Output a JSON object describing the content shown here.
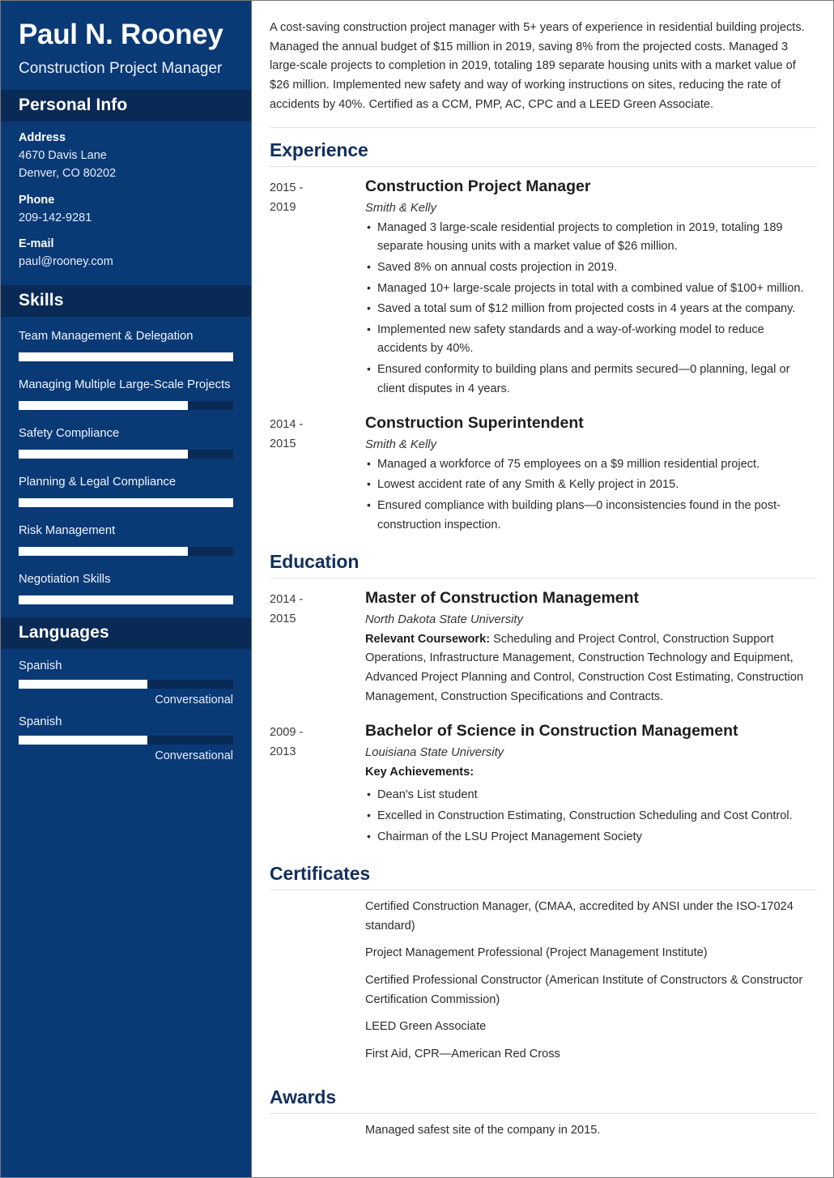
{
  "sidebar": {
    "name": "Paul N. Rooney",
    "job_title": "Construction Project Manager",
    "personal_info": {
      "heading": "Personal Info",
      "address_label": "Address",
      "address_line1": "4670 Davis Lane",
      "address_line2": "Denver, CO 80202",
      "phone_label": "Phone",
      "phone_value": "209-142-9281",
      "email_label": "E-mail",
      "email_value": "paul@rooney.com"
    },
    "skills": {
      "heading": "Skills",
      "items": [
        {
          "label": "Team Management & Delegation",
          "level": 100
        },
        {
          "label": "Managing Multiple Large-Scale Projects",
          "level": 79
        },
        {
          "label": "Safety Compliance",
          "level": 79
        },
        {
          "label": "Planning & Legal Compliance",
          "level": 100
        },
        {
          "label": "Risk Management",
          "level": 79
        },
        {
          "label": "Negotiation Skills",
          "level": 100
        }
      ]
    },
    "languages": {
      "heading": "Languages",
      "items": [
        {
          "label": "Spanish",
          "level": 60,
          "proficiency": "Conversational"
        },
        {
          "label": "Spanish",
          "level": 60,
          "proficiency": "Conversational"
        }
      ]
    }
  },
  "main": {
    "summary": "A cost-saving construction project manager with 5+ years of experience in residential building projects. Managed the annual budget of $15 million in 2019, saving 8% from the projected costs. Managed 3 large-scale projects to completion in 2019, totaling 189 separate housing units with a market value of $26 million. Implemented new safety and way of working instructions on sites, reducing the rate of accidents by 40%. Certified as a CCM, PMP, AC, CPC and a LEED Green Associate.",
    "experience": {
      "heading": "Experience",
      "entries": [
        {
          "dates": "2015 - 2019",
          "title": "Construction Project Manager",
          "company": "Smith & Kelly",
          "bullets": [
            "Managed 3 large-scale residential projects to completion in 2019, totaling 189 separate housing units with a market value of $26 million.",
            "Saved 8% on annual costs projection in 2019.",
            "Managed 10+ large-scale projects in total with a combined value of $100+ million.",
            "Saved a total sum of $12 million from projected costs in 4 years at the company.",
            "Implemented new safety standards and a way-of-working model to reduce accidents by 40%.",
            "Ensured conformity to building plans and permits secured—0 planning, legal or client disputes in 4 years."
          ]
        },
        {
          "dates": "2014 - 2015",
          "title": "Construction Superintendent",
          "company": "Smith & Kelly",
          "bullets": [
            "Managed a workforce of 75 employees on a $9 million residential project.",
            "Lowest accident rate of any Smith & Kelly project in 2015.",
            "Ensured compliance with building plans—0 inconsistencies found in the post-construction inspection."
          ]
        }
      ]
    },
    "education": {
      "heading": "Education",
      "entries": [
        {
          "dates": "2014 - 2015",
          "title": "Master of Construction Management",
          "school": "North Dakota State University",
          "note_label": "Relevant Coursework:",
          "note_text": " Scheduling and Project Control, Construction Support Operations, Infrastructure Management, Construction Technology and Equipment, Advanced Project Planning and Control, Construction Cost Estimating, Construction Management, Construction Specifications and Contracts.",
          "bullets": []
        },
        {
          "dates": "2009 - 2013",
          "title": "Bachelor of Science in Construction Management",
          "school": "Louisiana State University",
          "note_label": "Key Achievements:",
          "note_text": "",
          "bullets": [
            "Dean's List student",
            "Excelled in Construction Estimating, Construction Scheduling and Cost Control.",
            "Chairman of the LSU Project Management Society"
          ]
        }
      ]
    },
    "certificates": {
      "heading": "Certificates",
      "items": [
        "Certified Construction Manager, (CMAA, accredited by ANSI under the ISO-17024 standard)",
        "Project Management Professional (Project Management Institute)",
        "Certified Professional Constructor (American Institute of Constructors & Constructor Certification Commission)",
        "LEED Green Associate",
        "First Aid, CPR—American Red Cross"
      ]
    },
    "awards": {
      "heading": "Awards",
      "items": [
        "Managed safest site of the company in 2015."
      ]
    }
  },
  "colors": {
    "sidebar_bg": "#0a3a76",
    "sidebar_head_bg": "#0a2a56",
    "heading_navy": "#12305e",
    "bar_fill": "#ffffff"
  }
}
